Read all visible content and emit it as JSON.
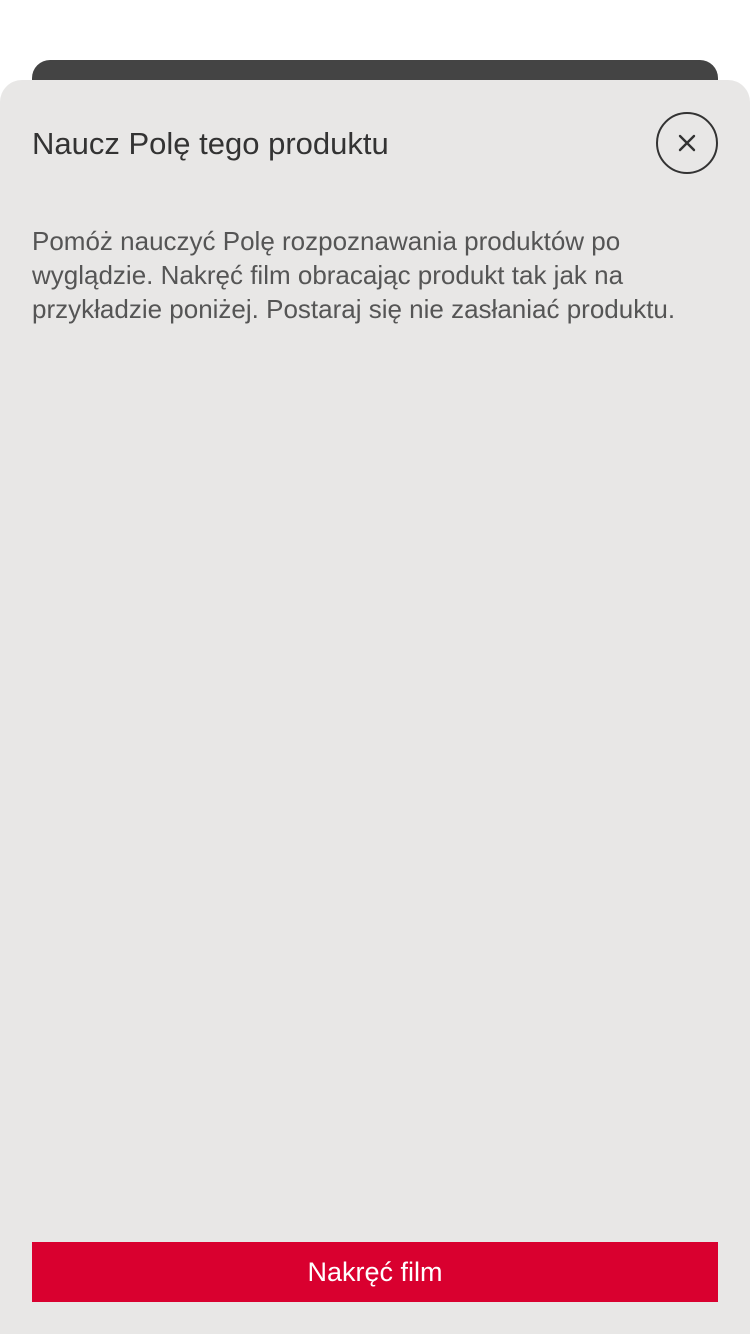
{
  "sheet": {
    "title": "Naucz Polę tego produktu",
    "description": "Pomóż nauczyć Polę rozpoznawania produktów po wyglądzie. Nakręć film obracając produkt tak jak na przykładzie poniżej. Postaraj się nie zasłaniać produktu.",
    "close_icon": "close-icon",
    "primary_button_label": "Nakręć film"
  },
  "colors": {
    "sheet_background": "#e8e7e6",
    "underlying_card": "#444444",
    "accent": "#d9002f",
    "text_primary": "#333333",
    "text_secondary": "#555555"
  }
}
